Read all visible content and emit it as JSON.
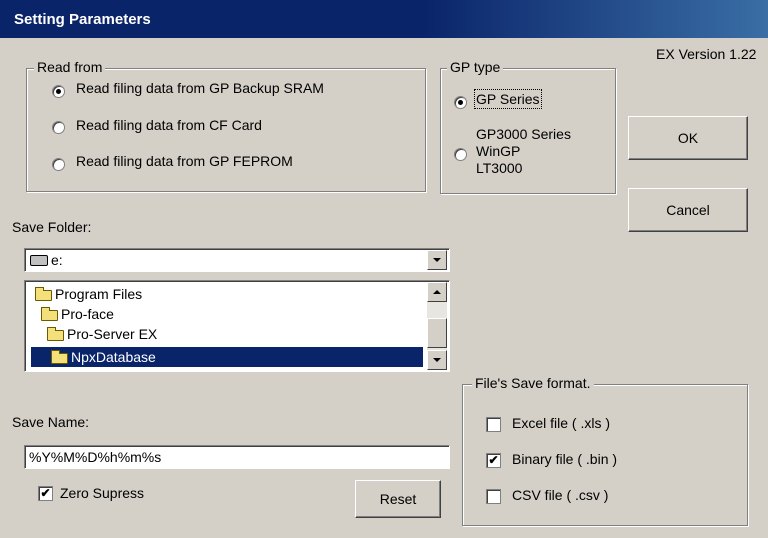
{
  "dialog": {
    "title": "Setting Parameters",
    "version": "EX Version 1.22"
  },
  "read_from": {
    "legend": "Read from",
    "options": [
      {
        "label": "Read filing data from GP Backup SRAM",
        "selected": true
      },
      {
        "label": "Read filing data from CF Card",
        "selected": false
      },
      {
        "label": "Read filing data from GP FEPROM",
        "selected": false
      }
    ]
  },
  "gp_type": {
    "legend": "GP type",
    "options": [
      {
        "label": "GP Series",
        "selected": true
      },
      {
        "label_lines": [
          "GP3000 Series",
          "WinGP",
          "LT3000"
        ],
        "selected": false
      }
    ]
  },
  "buttons": {
    "ok": "OK",
    "cancel": "Cancel",
    "reset": "Reset"
  },
  "save_folder": {
    "label": "Save Folder:",
    "drive": "e:",
    "folders": [
      {
        "name": "Program Files",
        "selected": false
      },
      {
        "name": "Pro-face",
        "selected": false
      },
      {
        "name": "Pro-Server EX",
        "selected": false
      },
      {
        "name": "NpxDatabase",
        "selected": true
      }
    ]
  },
  "save_name": {
    "label": "Save Name:",
    "value": "%Y%M%D%h%m%s"
  },
  "zero_supress": {
    "label": "Zero Supress",
    "checked": true
  },
  "save_format": {
    "legend": "File's Save format.",
    "options": [
      {
        "label": "Excel file  ( .xls )",
        "checked": false
      },
      {
        "label": "Binary file ( .bin )",
        "checked": true
      },
      {
        "label": "CSV file ( .csv )",
        "checked": false
      }
    ]
  },
  "colors": {
    "face": "#d4d0c8",
    "title_bar": "#0a246a",
    "selection": "#0a246a"
  }
}
